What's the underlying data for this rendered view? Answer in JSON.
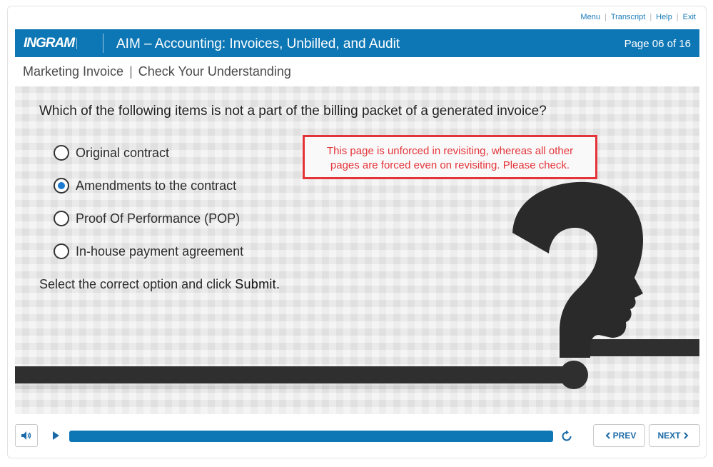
{
  "top_links": {
    "menu": "Menu",
    "transcript": "Transcript",
    "help": "Help",
    "exit": "Exit"
  },
  "banner": {
    "logo": "INGRAM",
    "title": "AIM – Accounting: Invoices, Unbilled, and Audit",
    "page_indicator": "Page 06 of 16",
    "color": "#0d77b5"
  },
  "breadcrumb": {
    "section": "Marketing Invoice",
    "page": "Check Your Understanding"
  },
  "quiz": {
    "question": "Which of the following items is not a part of the billing packet of a generated invoice?",
    "options": [
      {
        "label": "Original contract",
        "selected": false
      },
      {
        "label": "Amendments to the contract",
        "selected": true
      },
      {
        "label": "Proof Of Performance (POP)",
        "selected": false
      },
      {
        "label": "In-house payment agreement",
        "selected": false
      }
    ],
    "instruction_prefix": "Select the correct option and click",
    "instruction_action": "Submit."
  },
  "review_note": {
    "line1": "This page is unforced in revisiting, whereas all other",
    "line2": "pages are forced even on revisiting. Please check.",
    "color": "#e4343a"
  },
  "controls": {
    "prev_label": "PREV",
    "next_label": "NEXT",
    "progress": 1.0,
    "icons": [
      "speaker-icon",
      "play-icon",
      "replay-icon",
      "chevron-left-icon",
      "chevron-right-icon"
    ]
  }
}
